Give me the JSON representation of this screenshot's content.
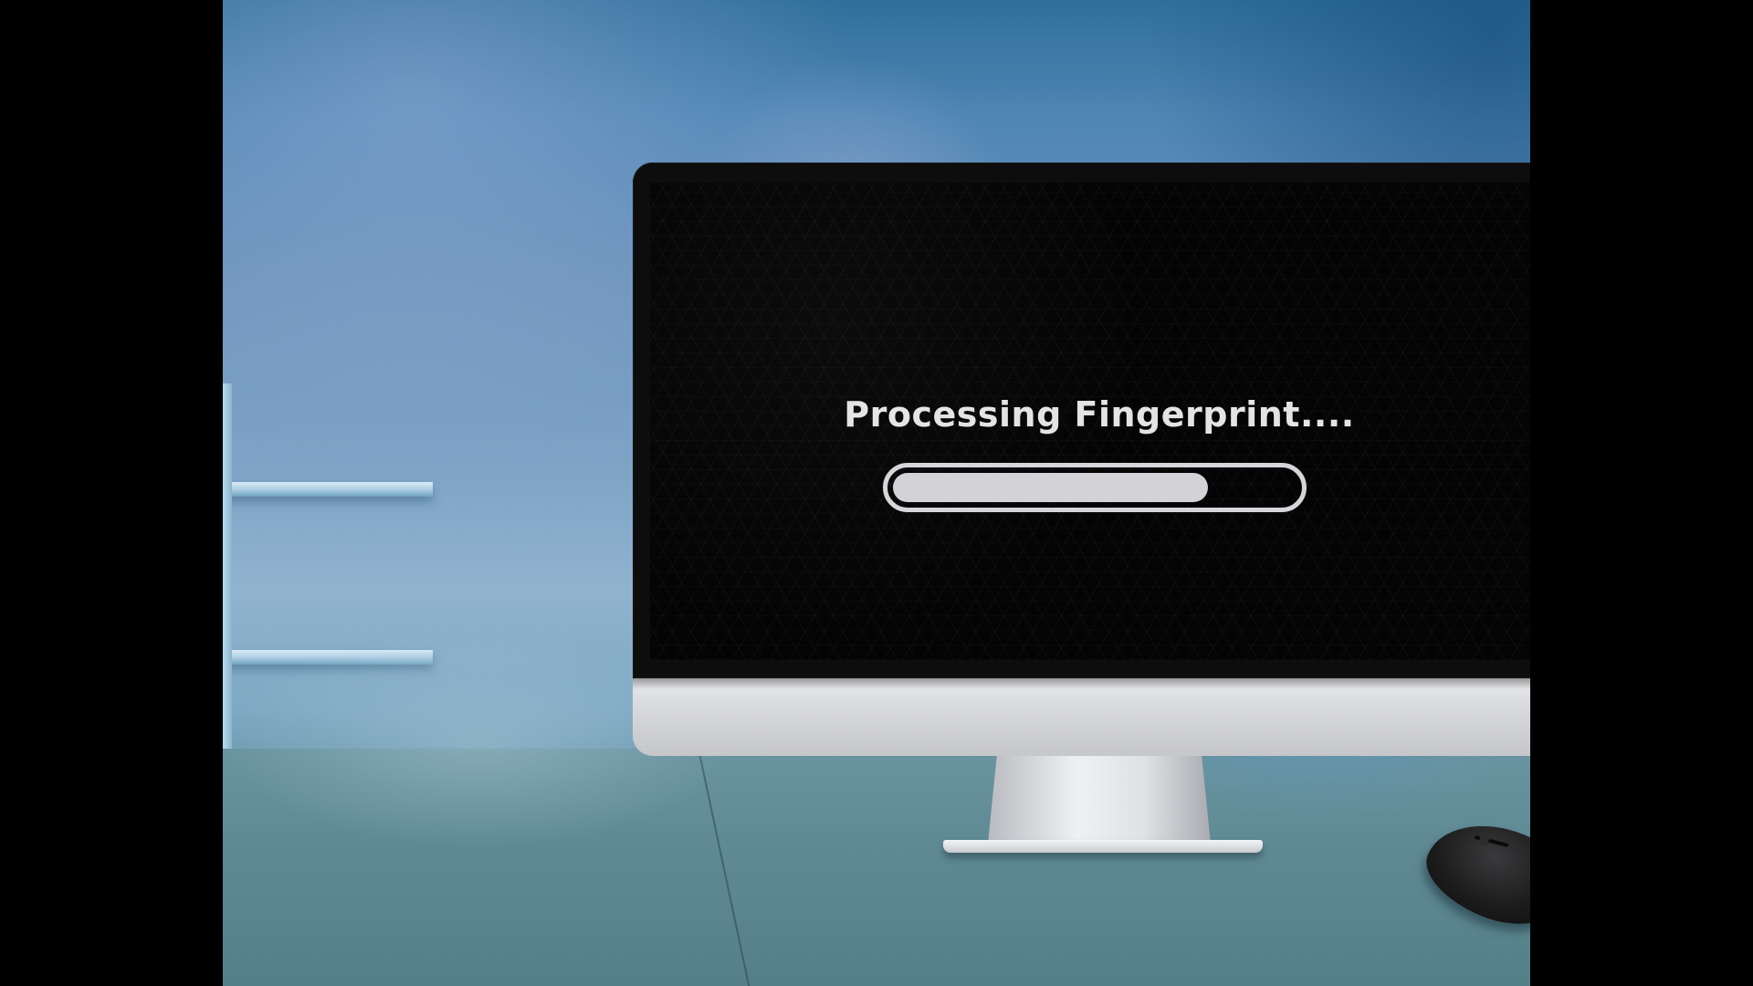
{
  "screen": {
    "title": "Processing Fingerprint....",
    "progress_percent": 78
  },
  "colors": {
    "screen_bg": "#040404",
    "text": "#e4e4e6",
    "progress": "#d3d3d7",
    "bezel": "#0d0d0e",
    "wall": "#7fa4c6"
  },
  "icons": {
    "mouse": "computer-mouse"
  }
}
